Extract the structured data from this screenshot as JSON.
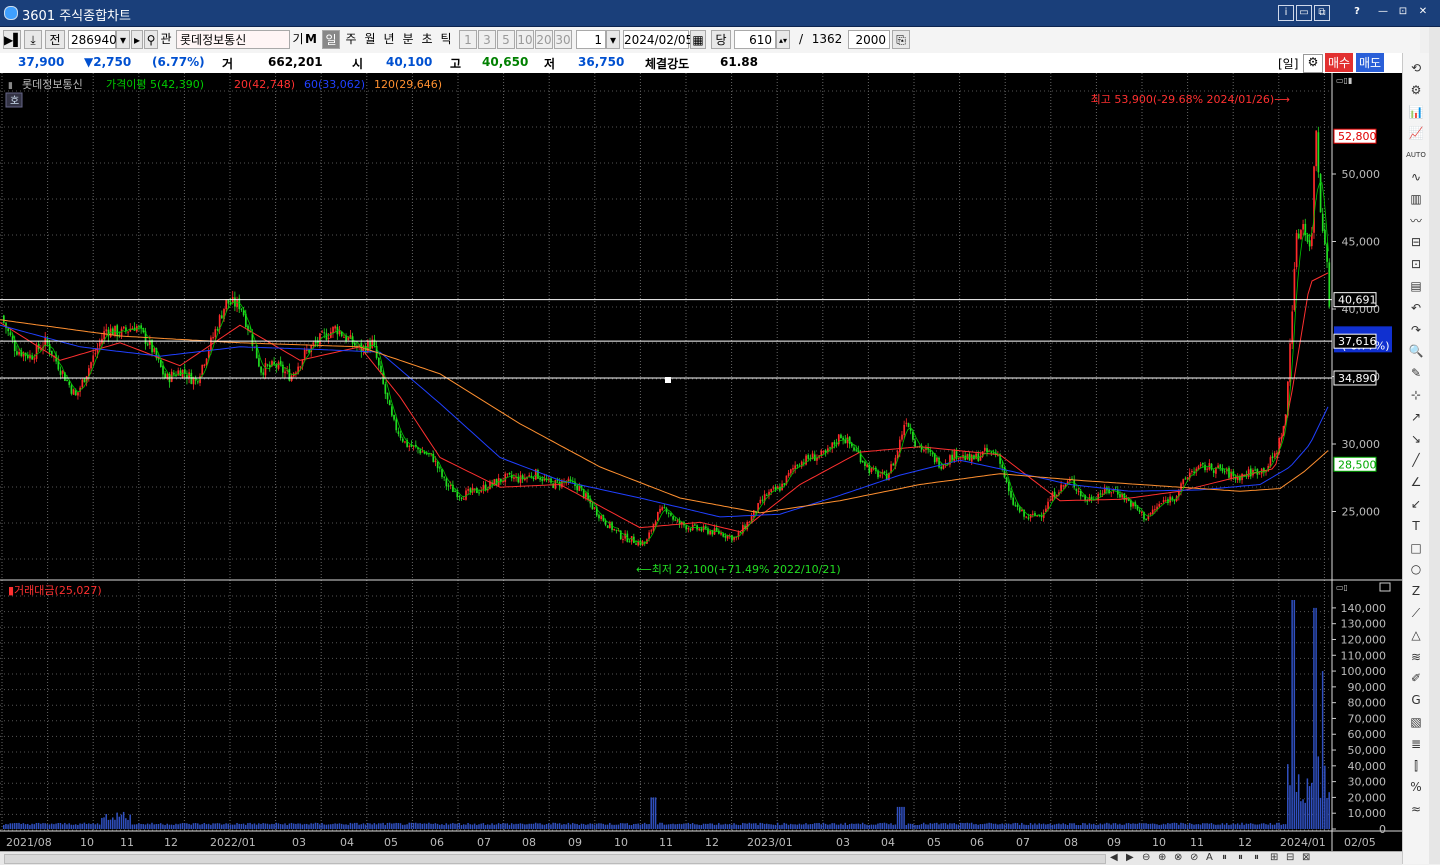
{
  "window": {
    "title": "3601 주식종합차트",
    "controls": [
      "i",
      "▭",
      "⧉",
      "?",
      "—",
      "⊡",
      "✕"
    ]
  },
  "toolbar": {
    "jeon": "전",
    "code": "286940",
    "gwan": "관",
    "name": "롯데정보통신",
    "gi": "기",
    "m": "M",
    "periods": [
      "일",
      "주",
      "월",
      "년",
      "분",
      "초",
      "틱"
    ],
    "period_selected": "일",
    "minutes": [
      "1",
      "3",
      "5",
      "10",
      "20",
      "30"
    ],
    "count": "1",
    "date": "2024/02/05",
    "dang": "당",
    "bars": "610",
    "slash": "/",
    "total": "1362",
    "zoom": "2000"
  },
  "quote": {
    "price": "37,900",
    "change": "▼2,750",
    "change_pct": "(6.77%)",
    "vol_label": "거",
    "volume": "662,201",
    "open_label": "시",
    "open": "40,100",
    "high_label": "고",
    "high": "40,650",
    "low_label": "저",
    "low": "36,750",
    "strength_label": "체결강도",
    "strength": "61.88",
    "il_btn": "[일]",
    "buy_btn": "매수",
    "sell_btn": "매도",
    "colors": {
      "up": "#e00000",
      "down": "#0050d0",
      "green": "#008000"
    }
  },
  "chart_data": [
    {
      "type": "candlestick",
      "title": "롯데정보통신",
      "legend": [
        {
          "name": "가격이평 5(42,390)",
          "color": "#00cc00"
        },
        {
          "name": "20(42,748)",
          "color": "#ff3030"
        },
        {
          "name": "60(33,062)",
          "color": "#2040ff"
        },
        {
          "name": "120(29,646)",
          "color": "#ff9030"
        }
      ],
      "ho_label": "호",
      "y_ticks": [
        "50,000",
        "45,000",
        "40,000",
        "35,000",
        "30,000",
        "25,000"
      ],
      "ylim": [
        20000,
        56000
      ],
      "x_ticks": [
        "2021/08",
        "10",
        "11",
        "12",
        "2022/01",
        "03",
        "04",
        "05",
        "06",
        "07",
        "08",
        "09",
        "10",
        "11",
        "12",
        "2023/01",
        "03",
        "04",
        "05",
        "06",
        "07",
        "08",
        "09",
        "10",
        "11",
        "12",
        "2024/01",
        "02/05"
      ],
      "annotations": {
        "high": "최고 53,900(-29.68% 2024/01/26)⟶",
        "low": "⟵최저 22,100(+71.49% 2022/10/21)"
      },
      "price_tags": {
        "max": "52,800",
        "line1": "40,691",
        "line2": "37,616",
        "current": "37,900",
        "current_pct": "(-6.77%)",
        "line3": "34,890",
        "min": "28,500"
      },
      "horizontal_lines": [
        40691,
        37616,
        34890
      ],
      "series_keypoints": [
        [
          0,
          39500
        ],
        [
          15,
          37000
        ],
        [
          30,
          36500
        ],
        [
          45,
          37600
        ],
        [
          60,
          35500
        ],
        [
          75,
          33500
        ],
        [
          90,
          36000
        ],
        [
          105,
          38500
        ],
        [
          120,
          38200
        ],
        [
          135,
          38800
        ],
        [
          150,
          37200
        ],
        [
          165,
          34800
        ],
        [
          180,
          35500
        ],
        [
          195,
          34600
        ],
        [
          210,
          37500
        ],
        [
          225,
          40500
        ],
        [
          240,
          40300
        ],
        [
          250,
          38000
        ],
        [
          260,
          35500
        ],
        [
          275,
          35800
        ],
        [
          290,
          35000
        ],
        [
          305,
          36800
        ],
        [
          320,
          37800
        ],
        [
          335,
          38600
        ],
        [
          345,
          37900
        ],
        [
          360,
          37000
        ],
        [
          372,
          37500
        ],
        [
          380,
          35000
        ],
        [
          392,
          31600
        ],
        [
          405,
          30000
        ],
        [
          420,
          29500
        ],
        [
          432,
          29000
        ],
        [
          445,
          27000
        ],
        [
          460,
          26200
        ],
        [
          475,
          26500
        ],
        [
          490,
          27000
        ],
        [
          505,
          27500
        ],
        [
          520,
          27400
        ],
        [
          535,
          27800
        ],
        [
          550,
          27000
        ],
        [
          565,
          27200
        ],
        [
          578,
          26800
        ],
        [
          590,
          25500
        ],
        [
          605,
          24200
        ],
        [
          620,
          23200
        ],
        [
          635,
          22800
        ],
        [
          645,
          22600
        ],
        [
          655,
          24600
        ],
        [
          665,
          25300
        ],
        [
          675,
          24200
        ],
        [
          690,
          23800
        ],
        [
          705,
          23600
        ],
        [
          720,
          23400
        ],
        [
          735,
          23000
        ],
        [
          750,
          24500
        ],
        [
          765,
          26200
        ],
        [
          780,
          26800
        ],
        [
          795,
          28500
        ],
        [
          810,
          29000
        ],
        [
          825,
          29200
        ],
        [
          840,
          30700
        ],
        [
          855,
          29500
        ],
        [
          870,
          28000
        ],
        [
          885,
          27500
        ],
        [
          895,
          29000
        ],
        [
          905,
          32000
        ],
        [
          915,
          30000
        ],
        [
          925,
          29500
        ],
        [
          940,
          28500
        ],
        [
          955,
          29300
        ],
        [
          970,
          28800
        ],
        [
          985,
          29400
        ],
        [
          998,
          29200
        ],
        [
          1010,
          25800
        ],
        [
          1025,
          24500
        ],
        [
          1040,
          24800
        ],
        [
          1055,
          26500
        ],
        [
          1070,
          27300
        ],
        [
          1085,
          25800
        ],
        [
          1100,
          26400
        ],
        [
          1115,
          26600
        ],
        [
          1130,
          25600
        ],
        [
          1145,
          24500
        ],
        [
          1160,
          25600
        ],
        [
          1175,
          26200
        ],
        [
          1190,
          28000
        ],
        [
          1205,
          28300
        ],
        [
          1220,
          28100
        ],
        [
          1235,
          27500
        ],
        [
          1250,
          27900
        ],
        [
          1265,
          28200
        ],
        [
          1275,
          29300
        ],
        [
          1285,
          32000
        ],
        [
          1295,
          45000
        ],
        [
          1303,
          46500
        ],
        [
          1310,
          44000
        ],
        [
          1315,
          53900
        ],
        [
          1320,
          47000
        ],
        [
          1325,
          45000
        ],
        [
          1330,
          37900
        ]
      ],
      "ma_curves": {
        "ma20": [
          [
            0,
            39000
          ],
          [
            60,
            36200
          ],
          [
            120,
            37500
          ],
          [
            180,
            35800
          ],
          [
            240,
            38800
          ],
          [
            300,
            36200
          ],
          [
            360,
            37200
          ],
          [
            400,
            33500
          ],
          [
            440,
            29000
          ],
          [
            500,
            26800
          ],
          [
            560,
            27000
          ],
          [
            640,
            23800
          ],
          [
            700,
            24200
          ],
          [
            740,
            23500
          ],
          [
            800,
            27000
          ],
          [
            860,
            29400
          ],
          [
            920,
            29800
          ],
          [
            1000,
            29200
          ],
          [
            1060,
            25800
          ],
          [
            1120,
            25900
          ],
          [
            1180,
            26500
          ],
          [
            1240,
            27600
          ],
          [
            1275,
            28200
          ],
          [
            1290,
            33000
          ],
          [
            1310,
            42000
          ],
          [
            1330,
            42748
          ]
        ],
        "ma60": [
          [
            0,
            38800
          ],
          [
            80,
            37200
          ],
          [
            160,
            36500
          ],
          [
            240,
            37200
          ],
          [
            320,
            37000
          ],
          [
            380,
            36800
          ],
          [
            440,
            33000
          ],
          [
            500,
            29000
          ],
          [
            560,
            27300
          ],
          [
            640,
            26000
          ],
          [
            720,
            24600
          ],
          [
            780,
            24800
          ],
          [
            840,
            26200
          ],
          [
            900,
            27700
          ],
          [
            960,
            28800
          ],
          [
            1010,
            28000
          ],
          [
            1070,
            27000
          ],
          [
            1130,
            26500
          ],
          [
            1200,
            26600
          ],
          [
            1260,
            27000
          ],
          [
            1290,
            28300
          ],
          [
            1310,
            30000
          ],
          [
            1330,
            33062
          ]
        ],
        "ma120": [
          [
            0,
            39200
          ],
          [
            120,
            38000
          ],
          [
            240,
            37500
          ],
          [
            360,
            37200
          ],
          [
            440,
            35200
          ],
          [
            520,
            31500
          ],
          [
            600,
            28300
          ],
          [
            680,
            26000
          ],
          [
            760,
            24900
          ],
          [
            840,
            25800
          ],
          [
            920,
            27000
          ],
          [
            1000,
            27800
          ],
          [
            1080,
            27300
          ],
          [
            1160,
            26900
          ],
          [
            1240,
            26500
          ],
          [
            1280,
            26700
          ],
          [
            1305,
            28000
          ],
          [
            1330,
            29646
          ]
        ]
      }
    },
    {
      "type": "bar",
      "title": "거래대금(25,027)",
      "y_ticks": [
        "140,000",
        "130,000",
        "120,000",
        "110,000",
        "100,000",
        "90,000",
        "80,000",
        "70,000",
        "60,000",
        "50,000",
        "40,000",
        "30,000",
        "20,000",
        "10,000",
        "0"
      ],
      "ylim": [
        0,
        145000
      ]
    }
  ],
  "bottom": {
    "tools": [
      "◀",
      "▶",
      "⊖",
      "⊕",
      "⊗",
      "⊘",
      "A",
      "⏸",
      "⏸",
      "⏸",
      "⊞",
      "⊟",
      "⊠"
    ]
  },
  "rightstrip": [
    "⟲",
    "⚙",
    "📊",
    "📈",
    "AUTO",
    "∿",
    "▥",
    "〰",
    "⊟",
    "⊡",
    "▤",
    "↶",
    "↷",
    "🔍",
    "✎",
    "⊹",
    "↗",
    "↘",
    "╱",
    "∠",
    "↙",
    "T",
    "□",
    "○",
    "Z",
    "⟋",
    "△",
    "≋",
    "✐",
    "G",
    "▧",
    "≣",
    "⫿",
    "%",
    "≈"
  ]
}
